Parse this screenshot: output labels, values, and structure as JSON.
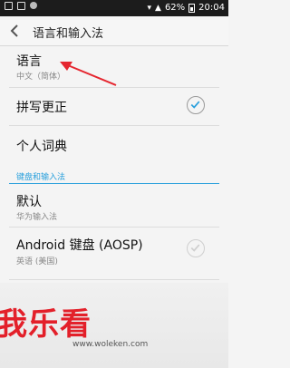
{
  "status_bar": {
    "battery": "62%",
    "time": "20:04"
  },
  "action_bar": {
    "title": "语言和输入法",
    "back_icon": "chevron-left-icon"
  },
  "rows": {
    "language": {
      "title": "语言",
      "subtitle": "中文（简体）"
    },
    "spellcheck": {
      "title": "拼写更正",
      "checked": true
    },
    "dictionary": {
      "title": "个人词典"
    },
    "section": {
      "header": "键盘和输入法"
    },
    "default": {
      "title": "默认",
      "subtitle": "华为输入法"
    },
    "aosp": {
      "title": "Android 键盘 (AOSP)",
      "subtitle": "英语 (美国)",
      "checked": true
    }
  },
  "watermark": {
    "brand": "我乐看",
    "url": "www.woleken.com"
  },
  "colors": {
    "accent": "#2aa0dc",
    "annotation_arrow": "#e5262f",
    "brand": "#e3202a"
  }
}
